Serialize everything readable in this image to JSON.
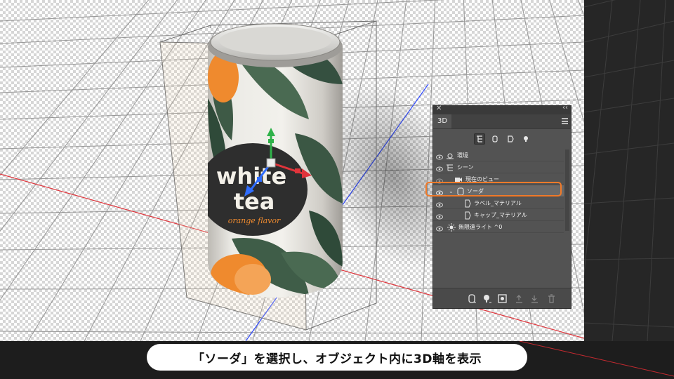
{
  "viewport": {
    "name": "3D canvas"
  },
  "can": {
    "label_line1": "white",
    "label_line2": "tea",
    "label_line3": "orange flavor",
    "colors": {
      "body": "#e9e7e2",
      "leaf": "#3f5a45",
      "orange": "#ef8a2e",
      "badge": "#2f2f2f"
    }
  },
  "panel": {
    "tab_label": "3D",
    "close_glyph": "✕",
    "collapse_glyph": "‹‹",
    "filters": [
      "scene-filter-icon",
      "mesh-filter-icon",
      "material-filter-icon",
      "light-filter-icon"
    ],
    "rows": [
      {
        "label": "環境",
        "icon": "environment-icon",
        "visible": true
      },
      {
        "label": "シーン",
        "icon": "scene-icon",
        "visible": true
      },
      {
        "label": "現在のビュー",
        "icon": "camera-icon",
        "visible": false
      },
      {
        "label": "ソーダ",
        "icon": "mesh-icon",
        "visible": true,
        "selected": true,
        "expanded": true
      },
      {
        "label": "ラベル_マテリアル",
        "icon": "material-icon",
        "visible": true
      },
      {
        "label": "キャップ_マテリアル",
        "icon": "material-icon",
        "visible": true
      },
      {
        "label": "無限遠ライト ^0",
        "icon": "light-icon",
        "visible": true
      }
    ],
    "bottom_icons": [
      "add-mesh-icon",
      "add-light-icon",
      "render-icon",
      "export-icon",
      "add-new-icon",
      "delete-icon"
    ],
    "highlight_color": "#f07a2a"
  },
  "caption": {
    "text": "「ソーダ」を選択し、オブジェクト内に3D軸を表示"
  }
}
